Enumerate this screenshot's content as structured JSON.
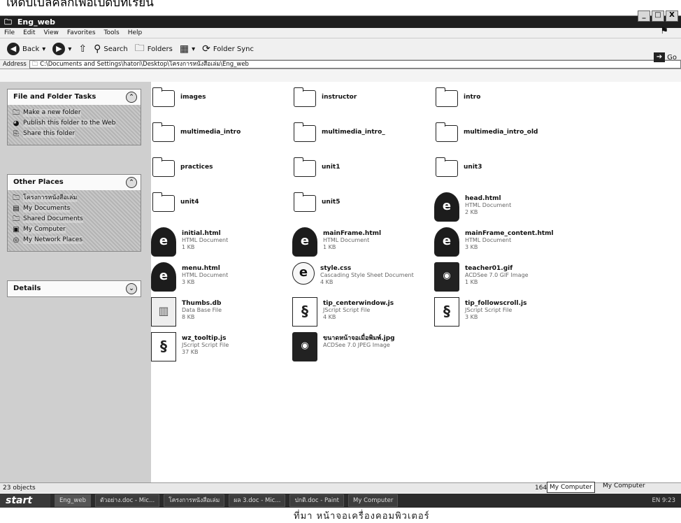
{
  "caption": "ให้ดับเบิลคลิกเพื่อเปิดบทเรียน",
  "window": {
    "title": "Eng_web",
    "controls": [
      "_",
      "□",
      "X"
    ]
  },
  "menu": [
    "File",
    "Edit",
    "View",
    "Favorites",
    "Tools",
    "Help"
  ],
  "toolbar": {
    "back": "Back",
    "search": "Search",
    "folders": "Folders",
    "folder_sync": "Folder Sync",
    "go": "Go"
  },
  "address": {
    "label": "Address",
    "value": "C:\\Documents and Settings\\hatori\\Desktop\\โครงการหนังสือเล่ม\\Eng_web"
  },
  "tasks": {
    "file_folder": {
      "title": "File and Folder Tasks",
      "items": [
        "Make a new folder",
        "Publish this folder to the Web",
        "Share this folder"
      ]
    },
    "other_places": {
      "title": "Other Places",
      "items": [
        "โครงการหนังสือเล่ม",
        "My Documents",
        "Shared Documents",
        "My Computer",
        "My Network Places"
      ]
    },
    "details": {
      "title": "Details"
    }
  },
  "files": [
    {
      "name": "images",
      "kind": "folder"
    },
    {
      "name": "instructor",
      "kind": "folder"
    },
    {
      "name": "intro",
      "kind": "folder"
    },
    {
      "name": "multimedia_intro",
      "kind": "folder"
    },
    {
      "name": "multimedia_intro_",
      "kind": "folder"
    },
    {
      "name": "multimedia_intro_old",
      "kind": "folder"
    },
    {
      "name": "practices",
      "kind": "folder"
    },
    {
      "name": "unit1",
      "kind": "folder"
    },
    {
      "name": "unit3",
      "kind": "folder"
    },
    {
      "name": "unit4",
      "kind": "folder"
    },
    {
      "name": "unit5",
      "kind": "folder"
    },
    {
      "name": "head.html",
      "kind": "ie",
      "type": "HTML Document",
      "size": "2 KB"
    },
    {
      "name": "initial.html",
      "kind": "ie",
      "type": "HTML Document",
      "size": "1 KB"
    },
    {
      "name": "mainFrame.html",
      "kind": "ie",
      "type": "HTML Document",
      "size": "1 KB"
    },
    {
      "name": "mainFrame_content.html",
      "kind": "ie",
      "type": "HTML Document",
      "size": "3 KB"
    },
    {
      "name": "menu.html",
      "kind": "ie",
      "type": "HTML Document",
      "size": "3 KB"
    },
    {
      "name": "style.css",
      "kind": "css",
      "type": "Cascading Style Sheet Document",
      "size": "4 KB"
    },
    {
      "name": "teacher01.gif",
      "kind": "img",
      "type": "ACDSee 7.0 GIF Image",
      "size": "1 KB"
    },
    {
      "name": "Thumbs.db",
      "kind": "db",
      "type": "Data Base File",
      "size": "8 KB"
    },
    {
      "name": "tip_centerwindow.js",
      "kind": "script",
      "type": "JScript Script File",
      "size": "4 KB"
    },
    {
      "name": "tip_followscroll.js",
      "kind": "script",
      "type": "JScript Script File",
      "size": "3 KB"
    },
    {
      "name": "wz_tooltip.js",
      "kind": "script",
      "type": "JScript Script File",
      "size": "37 KB"
    },
    {
      "name": "ขนาดหน้าจอเมื่อพิมพ์.jpg",
      "kind": "img",
      "type": "ACDSee 7.0 JPEG Image",
      "size": ""
    }
  ],
  "status": {
    "count": "23 objects",
    "size": "164",
    "zone": "My Computer",
    "zone2": "My Computer"
  },
  "taskbar": {
    "start": "start",
    "buttons": [
      "Eng_web",
      "ตัวอย่าง.doc - Mic...",
      "โครงการหนังสือเล่ม",
      "ผล 3.doc - Mic...",
      "ปกติ.doc - Paint",
      "My Computer"
    ],
    "tray": "EN 9:23"
  },
  "footer": "ที่มา หน้าจอเครื่องคอมพิวเตอร์"
}
